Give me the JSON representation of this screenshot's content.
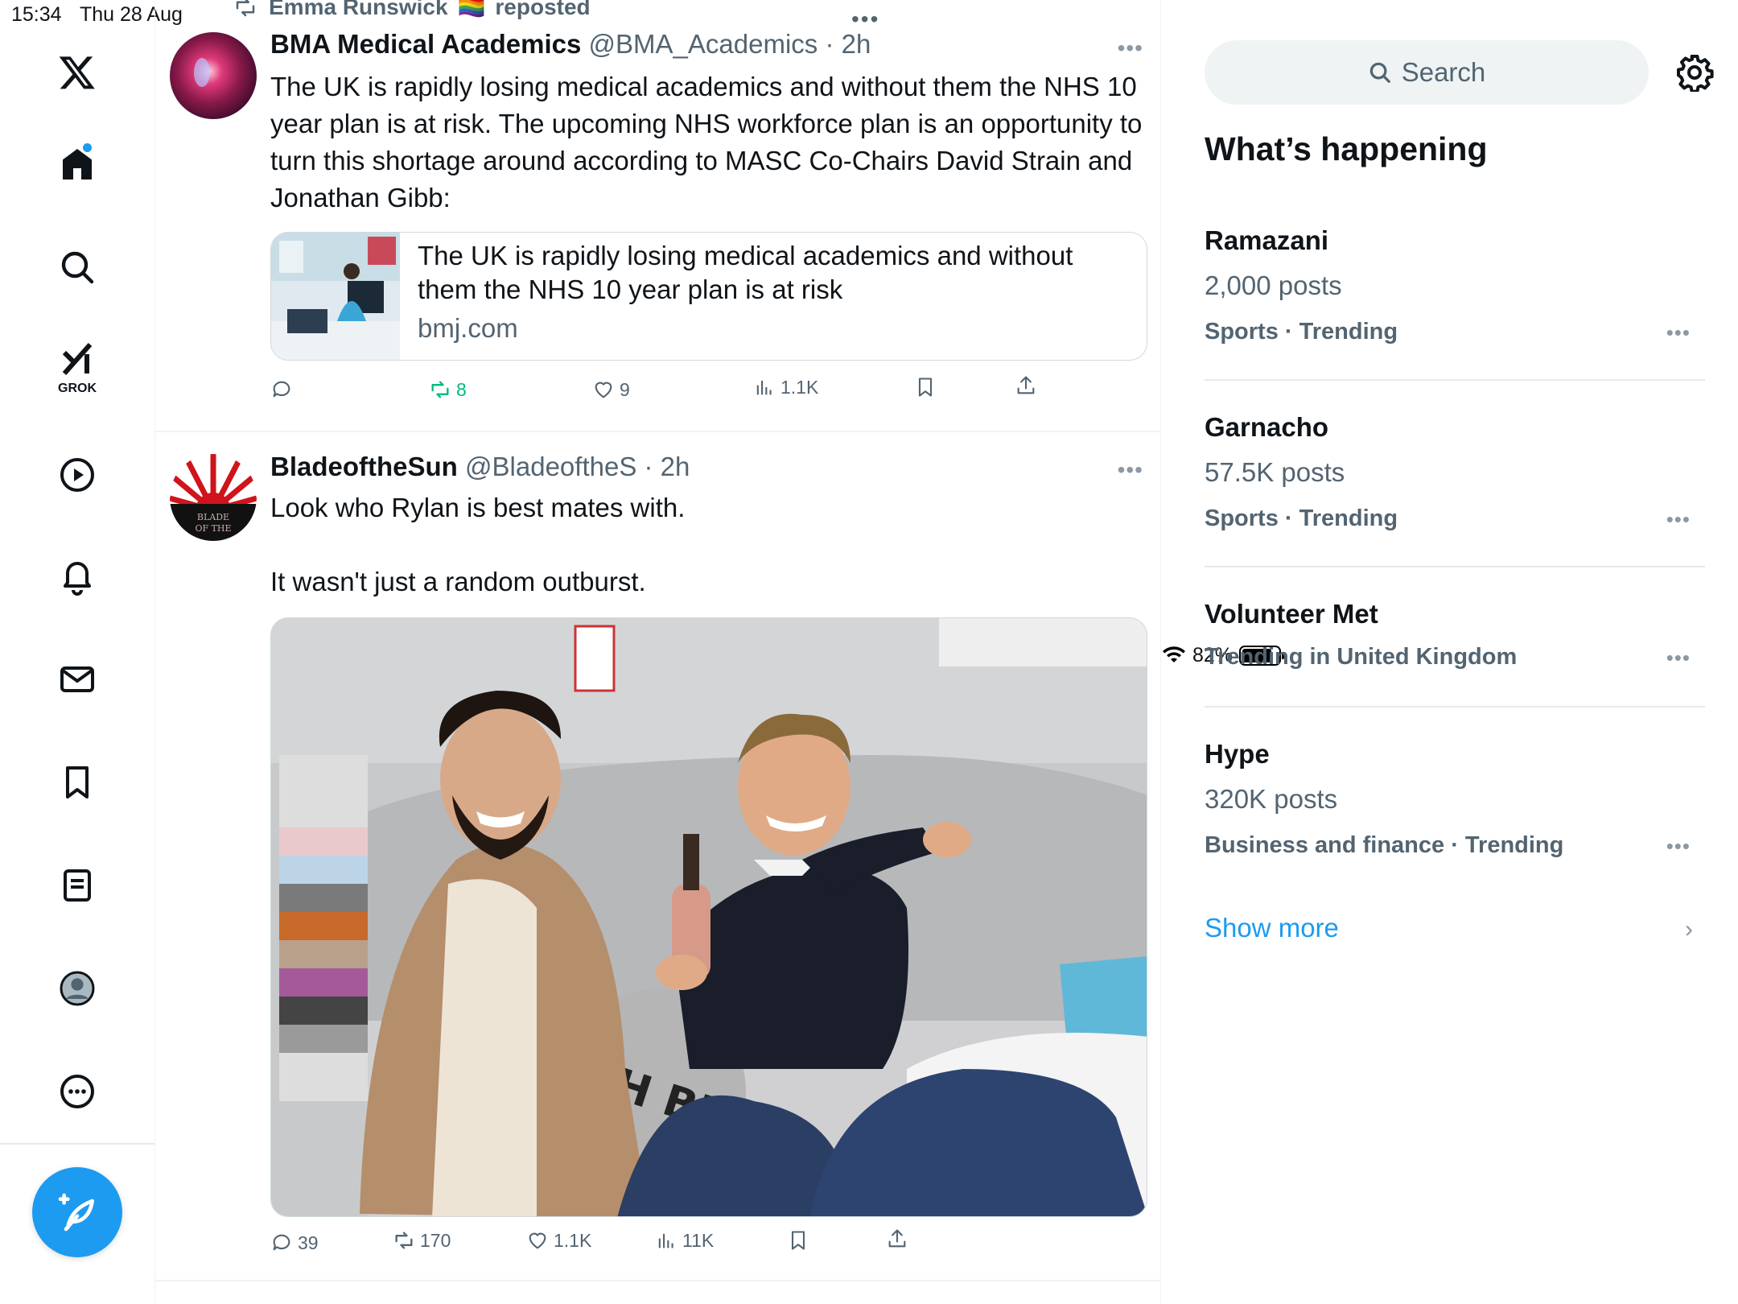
{
  "status_bar": {
    "time": "15:34",
    "date": "Thu 28 Aug",
    "battery": "82%",
    "battery_level": 0.82
  },
  "nav": {
    "items": [
      "x-logo",
      "home",
      "explore",
      "grok",
      "video",
      "notifications",
      "messages",
      "bookmarks",
      "lists",
      "profile",
      "more"
    ],
    "grok_label": "GROK"
  },
  "feed": {
    "repost": {
      "user": "Emma Runswick",
      "flag": "🏳️‍🌈",
      "label": "reposted"
    },
    "top_more": "•••",
    "posts": [
      {
        "name": "BMA Medical Academics",
        "handle": "@BMA_Academics",
        "sep": " · ",
        "time": "2h",
        "text": "The UK is rapidly losing medical academics and without them the NHS 10 year plan is at risk. The upcoming NHS workforce plan is an opportunity to turn this shortage around according to MASC Co-Chairs David Strain and Jonathan Gibb:",
        "card": {
          "title": "The UK is rapidly losing medical academics and without them the NHS 10 year plan is at risk",
          "domain": "bmj.com"
        },
        "replies": "",
        "reposts": "8",
        "likes": "9",
        "views": "1.1K"
      },
      {
        "name": "BladeoftheSun",
        "handle": "@BladeoftheS",
        "sep": " · ",
        "time": "2h",
        "text": "Look who Rylan is best mates with.\n\nIt wasn't just a random outburst.",
        "replies": "39",
        "reposts": "170",
        "likes": "1.1K",
        "views": "11K",
        "media_text": "BOSH BEDS"
      }
    ]
  },
  "right": {
    "search_placeholder": "Search",
    "title": "What’s happening",
    "trends": [
      {
        "name": "Ramazani",
        "count": "2,000 posts",
        "category": "Sports · Trending"
      },
      {
        "name": "Garnacho",
        "count": "57.5K posts",
        "category": "Sports · Trending"
      },
      {
        "name": "Volunteer Met",
        "count": "",
        "category": "Trending in United Kingdom"
      },
      {
        "name": "Hype",
        "count": "320K posts",
        "category": "Business and finance · Trending"
      }
    ],
    "show_more": "Show more"
  }
}
